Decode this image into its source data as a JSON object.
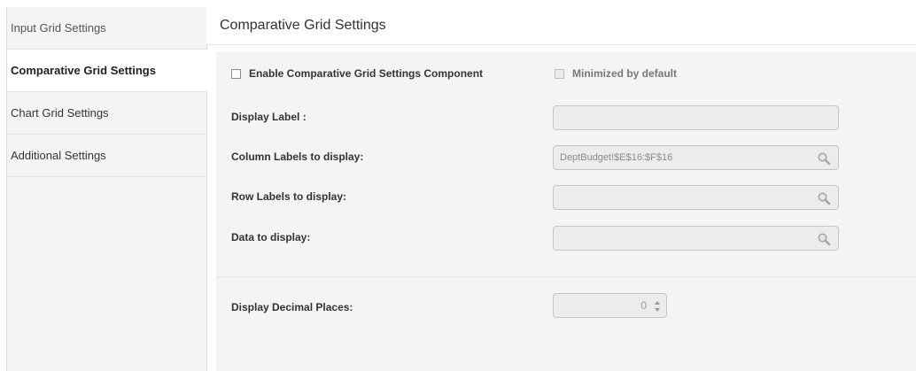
{
  "sidebar": {
    "items": [
      {
        "label": "Input Grid Settings"
      },
      {
        "label": "Comparative Grid Settings"
      },
      {
        "label": "Chart Grid Settings"
      },
      {
        "label": "Additional Settings"
      }
    ]
  },
  "header": {
    "title": "Comparative Grid Settings"
  },
  "options": {
    "enable_label": "Enable Comparative Grid Settings Component",
    "enable_checked": false,
    "minimized_label": "Minimized by default",
    "minimized_checked": false
  },
  "fields": {
    "display_label": {
      "label": "Display Label :",
      "value": ""
    },
    "column_labels": {
      "label": "Column Labels to display:",
      "value": "DeptBudget!$E$16:$F$16"
    },
    "row_labels": {
      "label": "Row Labels to display:",
      "value": ""
    },
    "data": {
      "label": "Data to display:",
      "value": ""
    }
  },
  "decimal": {
    "label": "Display Decimal Places:",
    "value": "0"
  },
  "icons": {
    "search": "magnifier-icon",
    "spinner_up": "chevron-up-icon",
    "spinner_down": "chevron-down-icon"
  }
}
